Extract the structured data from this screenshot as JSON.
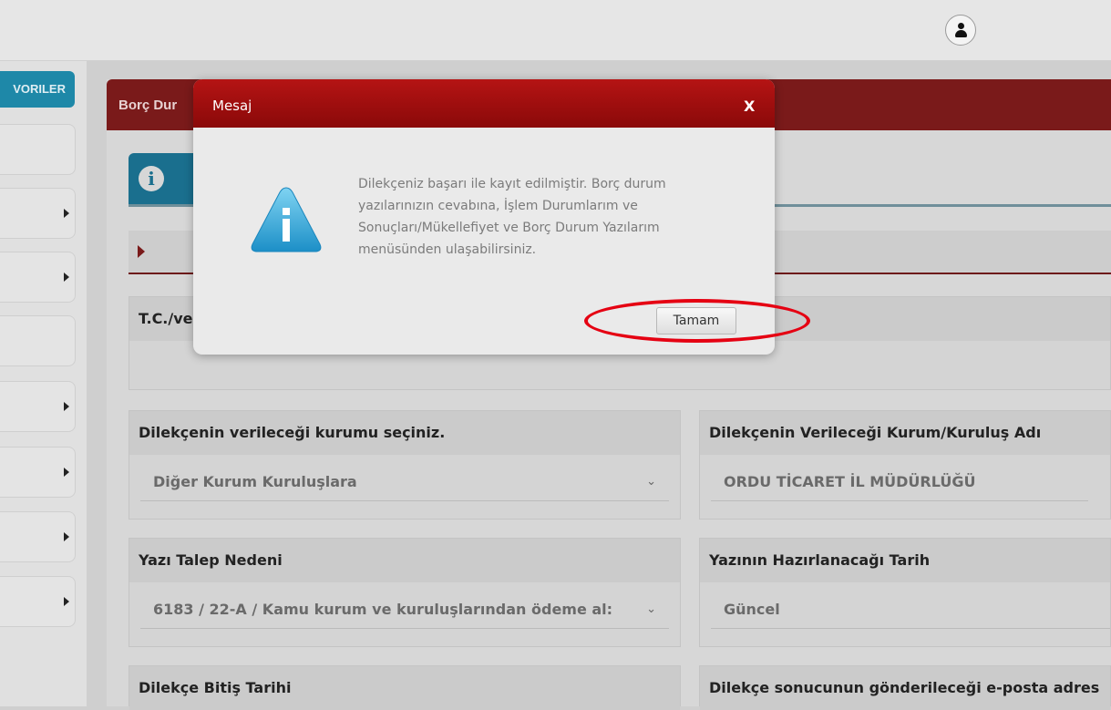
{
  "header": {
    "user_icon": "user-icon"
  },
  "sidebar": {
    "favorites_label": "VORILER",
    "items": [
      {
        "has_arrow": false
      },
      {
        "has_arrow": true
      },
      {
        "has_arrow": true
      },
      {
        "has_arrow": false
      },
      {
        "has_arrow": true
      },
      {
        "has_arrow": true
      },
      {
        "has_arrow": true
      },
      {
        "has_arrow": true
      }
    ]
  },
  "page": {
    "header_title": "Borç Dur",
    "tax_label": "T.C./ve"
  },
  "form": {
    "institution_select": {
      "label": "Dilekçenin verileceği kurumu seçiniz.",
      "value": "Diğer Kurum Kuruluşlara"
    },
    "institution_name": {
      "label": "Dilekçenin Verileceği Kurum/Kuruluş Adı",
      "value": "ORDU TİCARET İL MÜDÜRLÜĞÜ"
    },
    "request_reason": {
      "label": "Yazı Talep Nedeni",
      "value": "6183 / 22-A / Kamu kurum ve kuruluşlarından ödeme al:"
    },
    "prepare_date": {
      "label": "Yazının Hazırlanacağı Tarih",
      "value": "Güncel"
    },
    "end_date": {
      "label": "Dilekçe Bitiş Tarihi"
    },
    "email": {
      "label": "Dilekçe sonucunun gönderileceği e-posta adres"
    }
  },
  "modal": {
    "title": "Mesaj",
    "close_label": "X",
    "message_lines": [
      "Dilekçeniz başarı ile kayıt edilmiştir. Borç durum",
      "yazılarınızın cevabına, İşlem Durumlarım ve",
      "Sonuçları/Mükellefiyet ve Borç Durum Yazılarım",
      "menüsünden ulaşabilirsiniz."
    ],
    "ok_label": "Tamam",
    "icon": "info-icon"
  },
  "colors": {
    "modal_header": "#a50f0f",
    "page_header": "#7a1a1a",
    "favorites_button": "#1e88a8",
    "annotation_ellipse": "#e50012"
  }
}
